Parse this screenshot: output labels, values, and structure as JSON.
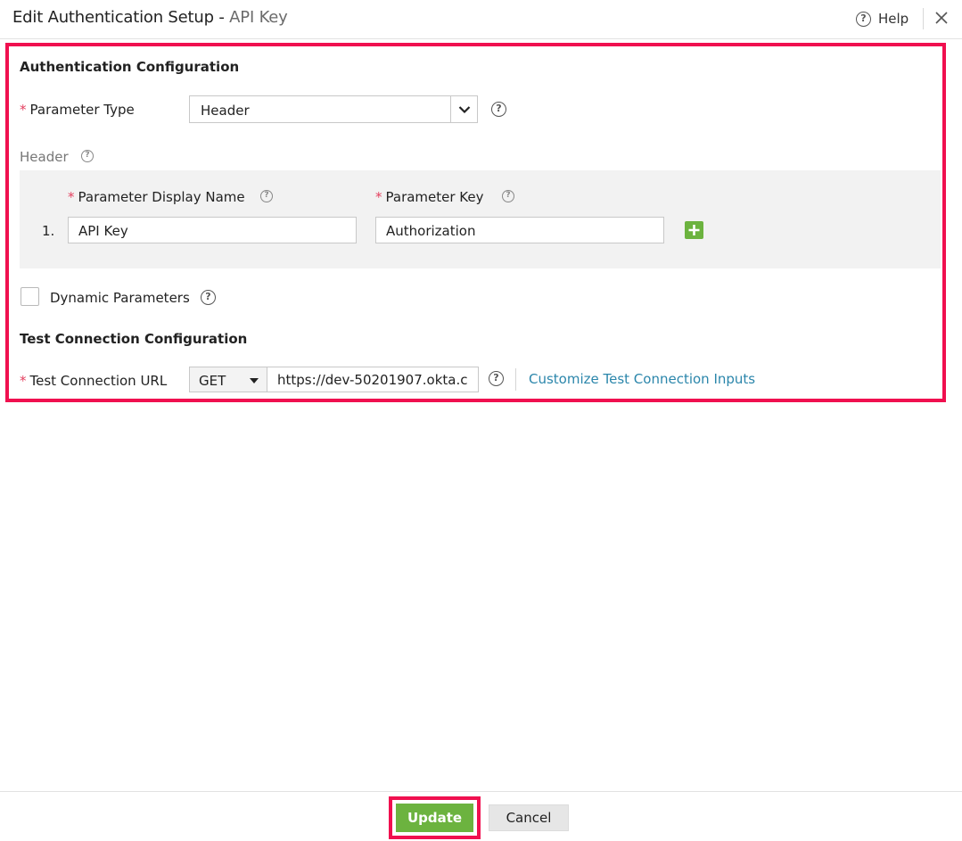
{
  "dialog": {
    "title": "Edit Authentication Setup",
    "title_separator": " - ",
    "subtitle": "API Key",
    "help_label": "Help"
  },
  "auth_config": {
    "section_title": "Authentication Configuration",
    "parameter_type_label": "Parameter Type",
    "parameter_type_value": "Header",
    "header_group_label": "Header",
    "display_name_label": "Parameter Display Name",
    "key_label": "Parameter Key",
    "rows": [
      {
        "index": "1.",
        "display_name": "API Key",
        "key": "Authorization"
      }
    ],
    "dynamic_parameters_label": "Dynamic Parameters",
    "dynamic_parameters_checked": false
  },
  "test_config": {
    "section_title": "Test Connection Configuration",
    "url_label": "Test Connection URL",
    "method": "GET",
    "url_value": "https://dev-50201907.okta.c",
    "customize_link": "Customize Test Connection Inputs"
  },
  "footer": {
    "update_label": "Update",
    "cancel_label": "Cancel"
  },
  "colors": {
    "accent_green": "#6cb33f",
    "highlight_red": "#f0104f",
    "link_blue": "#2b86ab",
    "required_red": "#e4405f"
  },
  "required_marker": "*",
  "help_glyph": "?",
  "icons": [
    "help-icon",
    "close-icon",
    "chevron-down-icon",
    "plus-icon",
    "caret-down-icon"
  ]
}
